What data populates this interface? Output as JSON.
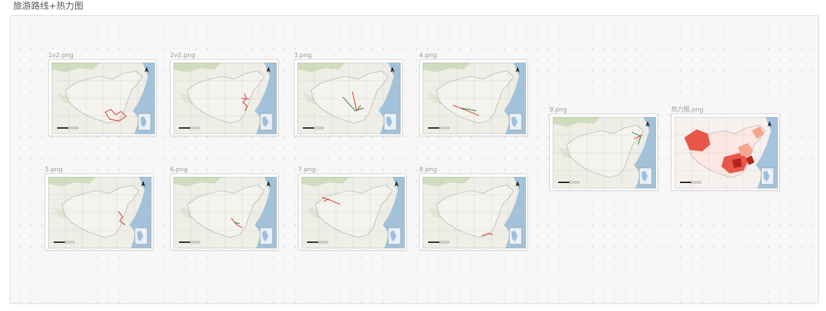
{
  "board": {
    "title": "旅游路线+热力图"
  },
  "cards": [
    {
      "label": "1v2.png",
      "icon": "map-image"
    },
    {
      "label": "2v2.png",
      "icon": "map-image"
    },
    {
      "label": "3.png",
      "icon": "map-image"
    },
    {
      "label": "4.png",
      "icon": "map-image"
    },
    {
      "label": "9.png",
      "icon": "map-image"
    },
    {
      "label": "热力图.png",
      "icon": "heatmap-image"
    },
    {
      "label": "5.png",
      "icon": "map-image"
    },
    {
      "label": "6.png",
      "icon": "map-image"
    },
    {
      "label": "7.png",
      "icon": "map-image"
    },
    {
      "label": "8.png",
      "icon": "map-image"
    }
  ],
  "colors": {
    "route_red": "#d9473a",
    "route_green": "#3c8f4a",
    "heat_dark": "#b5241c",
    "heat_mid": "#e8574a",
    "heat_light": "#f6a38f",
    "land": "#eeeee6",
    "sea": "#8ab3d6"
  }
}
